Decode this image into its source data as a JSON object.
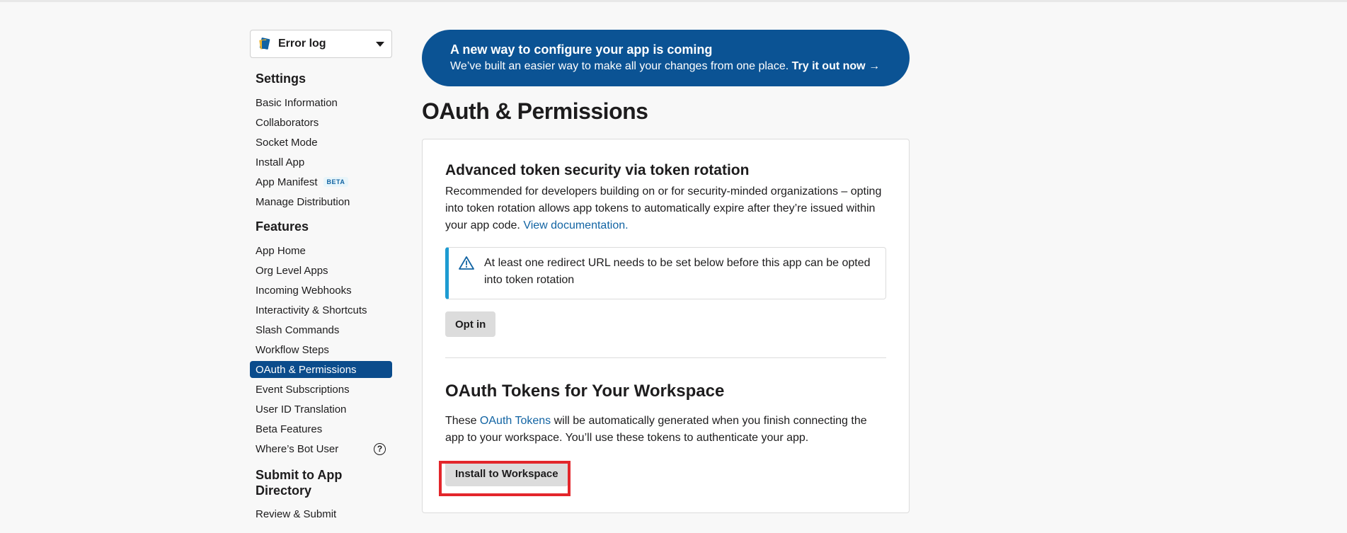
{
  "sidebar": {
    "app_name": "Error log",
    "settings_heading": "Settings",
    "settings_items": [
      {
        "label": "Basic Information"
      },
      {
        "label": "Collaborators"
      },
      {
        "label": "Socket Mode"
      },
      {
        "label": "Install App"
      },
      {
        "label": "App Manifest",
        "badge": "BETA"
      },
      {
        "label": "Manage Distribution"
      }
    ],
    "features_heading": "Features",
    "features_items": [
      {
        "label": "App Home"
      },
      {
        "label": "Org Level Apps"
      },
      {
        "label": "Incoming Webhooks"
      },
      {
        "label": "Interactivity & Shortcuts"
      },
      {
        "label": "Slash Commands"
      },
      {
        "label": "Workflow Steps"
      },
      {
        "label": "OAuth & Permissions",
        "active": true
      },
      {
        "label": "Event Subscriptions"
      },
      {
        "label": "User ID Translation"
      },
      {
        "label": "Beta Features"
      },
      {
        "label": "Where’s Bot User",
        "icon": "help-icon"
      }
    ],
    "submit_heading": "Submit to App Directory",
    "submit_items": [
      {
        "label": "Review & Submit"
      }
    ]
  },
  "banner": {
    "title": "A new way to configure your app is coming",
    "text": "We’ve built an easier way to make all your changes from one place.",
    "link": "Try it out now →"
  },
  "page": {
    "title": "OAuth & Permissions"
  },
  "token_rotation": {
    "title": "Advanced token security via token rotation",
    "description": "Recommended for developers building on or for security-minded organizations – opting into token rotation allows app tokens to automatically expire after they’re issued within your app code.",
    "link": "View documentation.",
    "alert": "At least one redirect URL needs to be set below before this app can be opted into token rotation",
    "button": "Opt in"
  },
  "oauth_tokens": {
    "title": "OAuth Tokens for Your Workspace",
    "text_before": "These",
    "link": "OAuth Tokens",
    "text_after": "will be automatically generated when you finish connecting the app to your workspace. You’ll use these tokens to authenticate your app.",
    "button": "Install to Workspace"
  },
  "colors": {
    "brand_blue": "#0b5394",
    "active_nav": "#0b4c8c",
    "link": "#1264a3",
    "alert_accent": "#1d9bd1",
    "highlight_red": "#e3262b"
  }
}
